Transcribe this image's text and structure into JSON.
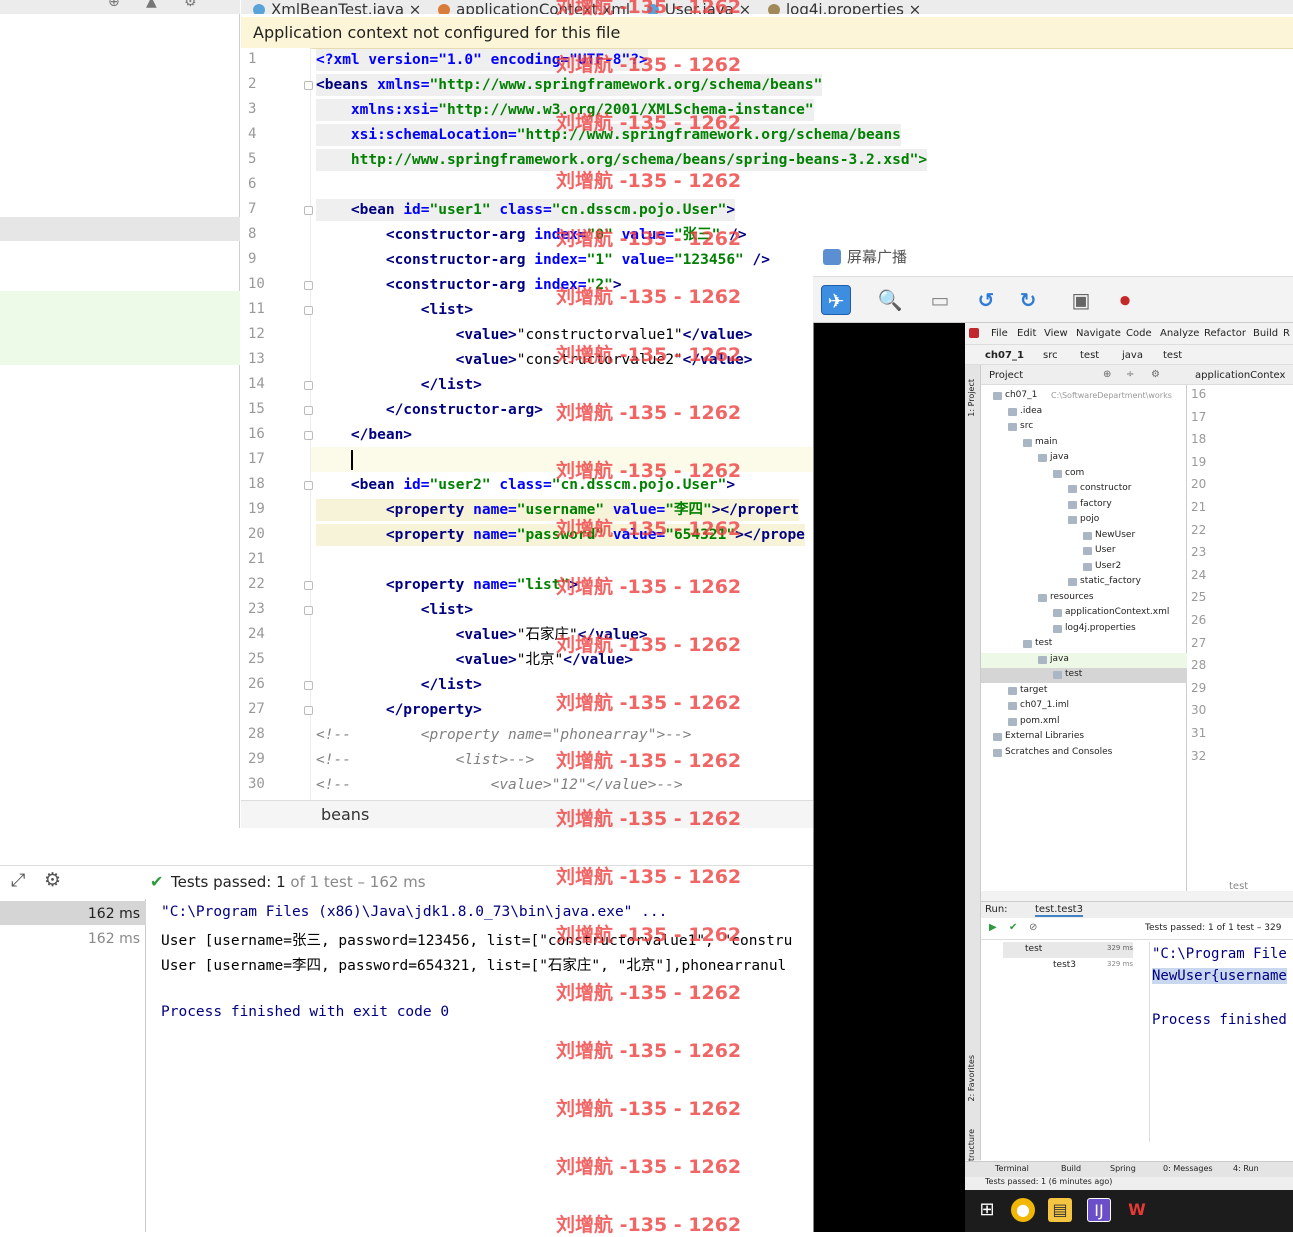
{
  "tabs": [
    {
      "label": "XmlBeanTest.java"
    },
    {
      "label": "applicationContext.xml"
    },
    {
      "label": "User.java"
    },
    {
      "label": "log4j.properties"
    }
  ],
  "banner": "Application context not configured for this file",
  "line_numbers": [
    "1",
    "2",
    "3",
    "4",
    "5",
    "6",
    "7",
    "8",
    "9",
    "10",
    "11",
    "12",
    "13",
    "14",
    "15",
    "16",
    "17",
    "18",
    "19",
    "20",
    "21",
    "22",
    "23",
    "24",
    "25",
    "26",
    "27",
    "28",
    "29",
    "30"
  ],
  "code": {
    "l1": "<?xml version=\"1.0\" encoding=\"UTF-8\"?>",
    "l2a": "<beans ",
    "l2b": "xmlns=",
    "l2c": "\"http://www.springframework.org/schema/beans\"",
    "l3a": "    xmlns:xsi=",
    "l3b": "\"http://www.w3.org/2001/XMLSchema-instance\"",
    "l4a": "    xsi:schemaLocation=",
    "l4b": "\"http://www.springframework.org/schema/beans",
    "l5": "    http://www.springframework.org/schema/beans/spring-beans-3.2.xsd\">",
    "l7a": "    <bean ",
    "l7b": "id=",
    "l7c": "\"user1\" ",
    "l7d": "class=",
    "l7e": "\"cn.dsscm.pojo.User\"",
    "l7f": ">",
    "l8a": "        <constructor-arg ",
    "l8b": "index=",
    "l8c": "\"0\" ",
    "l8d": "value=",
    "l8e": "\"张三\"",
    "l8f": " />",
    "l9a": "        <constructor-arg ",
    "l9b": "index=",
    "l9c": "\"1\" ",
    "l9d": "value=",
    "l9e": "\"123456\"",
    "l9f": " />",
    "l10a": "        <constructor-arg ",
    "l10b": "index=",
    "l10c": "\"2\"",
    "l10d": ">",
    "l11": "            <list>",
    "l12a": "                <value>",
    "l12b": "\"constructorvalue1\"",
    "l12c": "</value>",
    "l13a": "                <value>",
    "l13b": "\"constructorvalue2\"",
    "l13c": "</value>",
    "l14": "            </list>",
    "l15": "        </constructor-arg>",
    "l16": "    </bean>",
    "l18a": "    <bean ",
    "l18b": "id=",
    "l18c": "\"user2\" ",
    "l18d": "class=",
    "l18e": "\"cn.dsscm.pojo.User\"",
    "l18f": ">",
    "l19a": "        <property ",
    "l19b": "name=",
    "l19c": "\"username\" ",
    "l19d": "value=",
    "l19e": "\"李四\"",
    "l19f": "></propert",
    "l20a": "        <property ",
    "l20b": "name=",
    "l20c": "\"password\" ",
    "l20d": "value=",
    "l20e": "\"654321\"",
    "l20f": "></prope",
    "l22a": "        <property ",
    "l22b": "name=",
    "l22c": "\"list\"",
    "l22d": ">",
    "l23": "            <list>",
    "l24a": "                <value>",
    "l24b": "\"石家庄\"",
    "l24c": "</value>",
    "l25a": "                <value>",
    "l25b": "\"北京\"",
    "l25c": "</value>",
    "l26": "            </list>",
    "l27": "        </property>",
    "l28": "<!--        <property name=\"phonearray\">-->",
    "l29": "<!--            <list>-->",
    "l30": "<!--                <value>\"12\"</value>-->"
  },
  "breadcrumb": "beans",
  "run": {
    "status_prefix": "Tests passed:",
    "status_count": "1",
    "status_rest": "of 1 test – 162 ms",
    "times": [
      "162 ms",
      "162 ms"
    ],
    "console": [
      "\"C:\\Program Files (x86)\\Java\\jdk1.8.0_73\\bin\\java.exe\" ...",
      "User [username=张三, password=123456, list=[\"constructorvalue1\", \"constru",
      "User [username=李四, password=654321, list=[\"石家庄\", \"北京\"],phonearranul",
      "",
      "Process finished with exit code 0"
    ]
  },
  "watermark": "刘增航 -135 - 1262",
  "broadcast": {
    "title": "屏幕广播",
    "menu": [
      "File",
      "Edit",
      "View",
      "Navigate",
      "Code",
      "Analyze",
      "Refactor",
      "Build",
      "R"
    ],
    "nav": [
      "ch07_1",
      "src",
      "test",
      "java",
      "test"
    ],
    "project_header": "Project",
    "tab_file": "applicationContex",
    "tree": [
      {
        "label": "ch07_1",
        "extra": "C:\\SoftwareDepartment\\works",
        "depth": 0
      },
      {
        "label": ".idea",
        "depth": 1
      },
      {
        "label": "src",
        "depth": 1
      },
      {
        "label": "main",
        "depth": 2
      },
      {
        "label": "java",
        "depth": 3
      },
      {
        "label": "com",
        "depth": 4
      },
      {
        "label": "constructor",
        "depth": 5
      },
      {
        "label": "factory",
        "depth": 5
      },
      {
        "label": "pojo",
        "depth": 5
      },
      {
        "label": "NewUser",
        "depth": 6
      },
      {
        "label": "User",
        "depth": 6
      },
      {
        "label": "User2",
        "depth": 6
      },
      {
        "label": "static_factory",
        "depth": 5
      },
      {
        "label": "resources",
        "depth": 3
      },
      {
        "label": "applicationContext.xml",
        "depth": 4
      },
      {
        "label": "log4j.properties",
        "depth": 4
      },
      {
        "label": "test",
        "depth": 2
      },
      {
        "label": "java",
        "depth": 3
      },
      {
        "label": "test",
        "depth": 4
      },
      {
        "label": "target",
        "depth": 1
      },
      {
        "label": "ch07_1.iml",
        "depth": 1
      },
      {
        "label": "pom.xml",
        "depth": 1
      },
      {
        "label": "External Libraries",
        "depth": 0
      },
      {
        "label": "Scratches and Consoles",
        "depth": 0
      }
    ],
    "editor_lines": [
      "16",
      "17",
      "18",
      "19",
      "20",
      "21",
      "22",
      "23",
      "24",
      "25",
      "26",
      "27",
      "28",
      "29",
      "30",
      "31",
      "32"
    ],
    "editor_bottom": "test",
    "run_label": "Run:",
    "run_tab": "test.test3",
    "run_status": "Tests passed: 1 of 1 test – 329",
    "run_tree": [
      {
        "label": "test",
        "time": "329 ms"
      },
      {
        "label": "test3",
        "time": "329 ms"
      }
    ],
    "console": [
      "\"C:\\Program File",
      "NewUser{username",
      "",
      "Process finished"
    ],
    "bottom_tabs": [
      "Terminal",
      "Build",
      "Spring",
      "0: Messages",
      "4: Run"
    ],
    "statusbar": "Tests passed: 1 (6 minutes ago)",
    "side_labels": [
      "1: Project",
      "2: Favorites",
      "Z: Structure"
    ]
  }
}
